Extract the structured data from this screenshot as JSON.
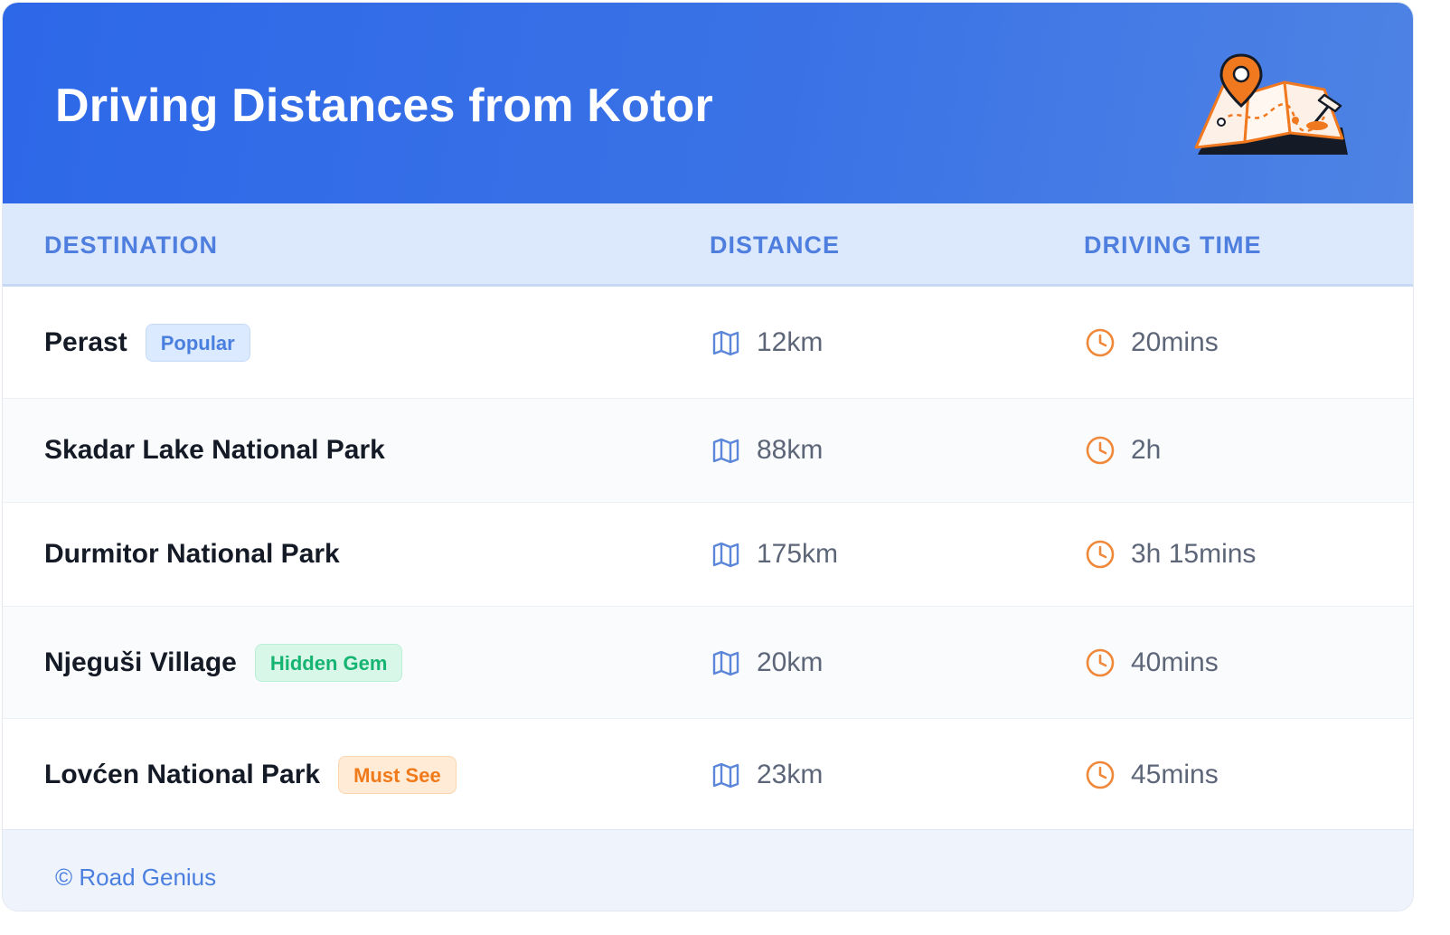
{
  "header": {
    "title": "Driving Distances from Kotor",
    "illustration_icon": "map-pin-illustration-icon"
  },
  "columns": {
    "destination": "DESTINATION",
    "distance": "DISTANCE",
    "driving_time": "DRIVING TIME"
  },
  "rows": [
    {
      "destination": "Perast",
      "badge": "Popular",
      "badge_color": "blue",
      "distance": "12km",
      "time": "20mins"
    },
    {
      "destination": "Skadar Lake National Park",
      "badge": "",
      "badge_color": "",
      "distance": "88km",
      "time": "2h"
    },
    {
      "destination": "Durmitor National Park",
      "badge": "",
      "badge_color": "",
      "distance": "175km",
      "time": "3h 15mins"
    },
    {
      "destination": "Njeguši Village",
      "badge": "Hidden Gem",
      "badge_color": "green",
      "distance": "20km",
      "time": "40mins"
    },
    {
      "destination": "Lovćen National Park",
      "badge": "Must See",
      "badge_color": "orange",
      "distance": "23km",
      "time": "45mins"
    }
  ],
  "icons": {
    "distance": "map-icon",
    "time": "clock-icon"
  },
  "colors": {
    "header_bg": "#2d68e8",
    "accent_blue": "#4a7fe0",
    "accent_orange": "#f0883a",
    "badge_green": "#16b472"
  },
  "footer": {
    "credit": "© Road Genius"
  }
}
